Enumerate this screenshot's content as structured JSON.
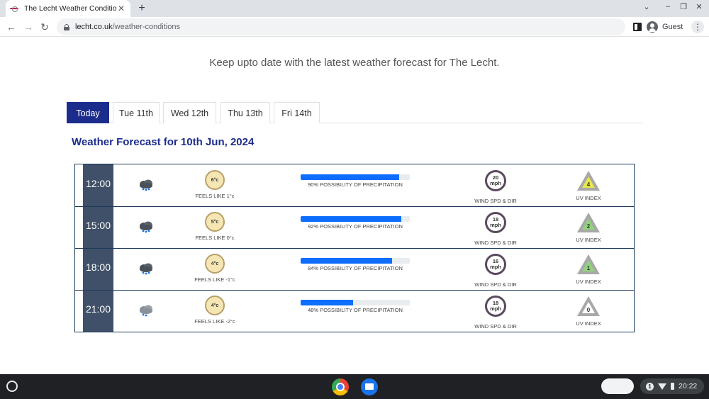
{
  "browser": {
    "tab_title": "The Lecht Weather Conditions",
    "url_domain": "lecht.co.uk",
    "url_path": "/weather-conditions",
    "profile_label": "Guest"
  },
  "page": {
    "intro": "Keep upto date with the latest weather forecast for The Lecht.",
    "day_tabs": [
      "Today",
      "Tue 11th",
      "Wed 12th",
      "Thu 13th",
      "Fri 14th"
    ],
    "active_tab": "Today",
    "forecast_heading": "Weather Forecast for 10th Jun, 2024",
    "wind_label": "WIND SPD & DIR",
    "uv_label": "UV INDEX",
    "wind_unit": "mph",
    "rows": [
      {
        "time": "12:00",
        "temp": "6°c",
        "feels": "FEELS LIKE 1°c",
        "precip_pct": 90,
        "precip_text": "90% POSSIBILITY OF PRECIPITATION",
        "wind": "20",
        "uv": "4",
        "uv_color": "#e8e84a",
        "icon": "heavy-rain-cloud-icon"
      },
      {
        "time": "15:00",
        "temp": "5°c",
        "feels": "FEELS LIKE 0°c",
        "precip_pct": 92,
        "precip_text": "92% POSSIBILITY OF PRECIPITATION",
        "wind": "18",
        "uv": "2",
        "uv_color": "#8fd47a",
        "icon": "heavy-rain-cloud-icon"
      },
      {
        "time": "18:00",
        "temp": "4°c",
        "feels": "FEELS LIKE -1°c",
        "precip_pct": 84,
        "precip_text": "84% POSSIBILITY OF PRECIPITATION",
        "wind": "16",
        "uv": "1",
        "uv_color": "#8fd47a",
        "icon": "heavy-rain-cloud-icon"
      },
      {
        "time": "21:00",
        "temp": "4°c",
        "feels": "FEELS LIKE -2°c",
        "precip_pct": 48,
        "precip_text": "48% POSSIBILITY OF PRECIPITATION",
        "wind": "18",
        "uv": "0",
        "uv_color": "#ffffff",
        "icon": "light-rain-cloud-icon"
      }
    ]
  },
  "shelf": {
    "notification_count": "1",
    "clock": "20:22"
  },
  "colors": {
    "brand_navy": "#1c2c8c",
    "time_column": "#3f5068",
    "precip_fill": "#0d6efd"
  }
}
